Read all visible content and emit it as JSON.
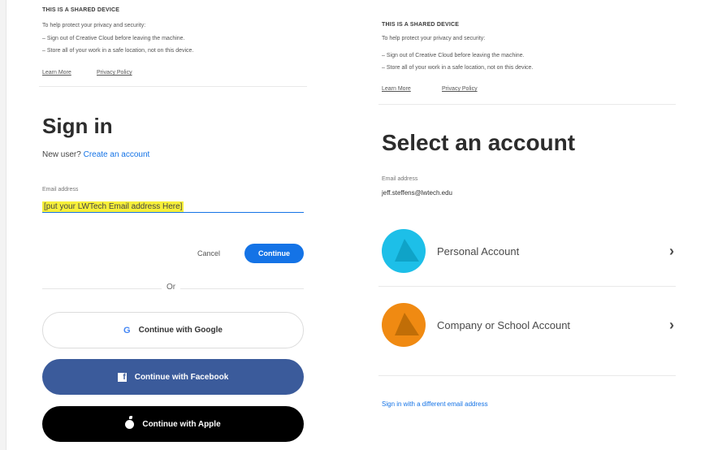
{
  "left": {
    "notice": {
      "title": "THIS IS A SHARED DEVICE",
      "intro": "To help protect your privacy and security:",
      "bullets": [
        "Sign out of Creative Cloud before leaving the machine.",
        "Store all of your work in a safe location, not on this device."
      ],
      "learn_more": "Learn More",
      "privacy_policy": "Privacy Policy"
    },
    "heading": "Sign in",
    "new_user_text": "New user?",
    "create_account": "Create an account",
    "email_label": "Email address",
    "email_value": "[put your LWTech Email address Here]",
    "cancel": "Cancel",
    "continue": "Continue",
    "or": "Or",
    "social": {
      "google": "Continue with Google",
      "facebook": "Continue with Facebook",
      "apple": "Continue with Apple"
    }
  },
  "right": {
    "notice": {
      "title": "THIS IS A SHARED DEVICE",
      "intro": "To help protect your privacy and security:",
      "bullets": [
        "Sign out of Creative Cloud before leaving the machine.",
        "Store all of your work in a safe location, not on this device."
      ],
      "learn_more": "Learn More",
      "privacy_policy": "Privacy Policy"
    },
    "heading": "Select an account",
    "email_label": "Email address",
    "email_value": "jeff.steffens@lwtech.edu",
    "accounts": [
      {
        "label": "Personal Account",
        "icon": "personal-account-icon",
        "color": "#1dbfe8"
      },
      {
        "label": "Company or School Account",
        "icon": "school-account-icon",
        "color": "#f08a12"
      }
    ],
    "different_email": "Sign in with a different email address"
  }
}
